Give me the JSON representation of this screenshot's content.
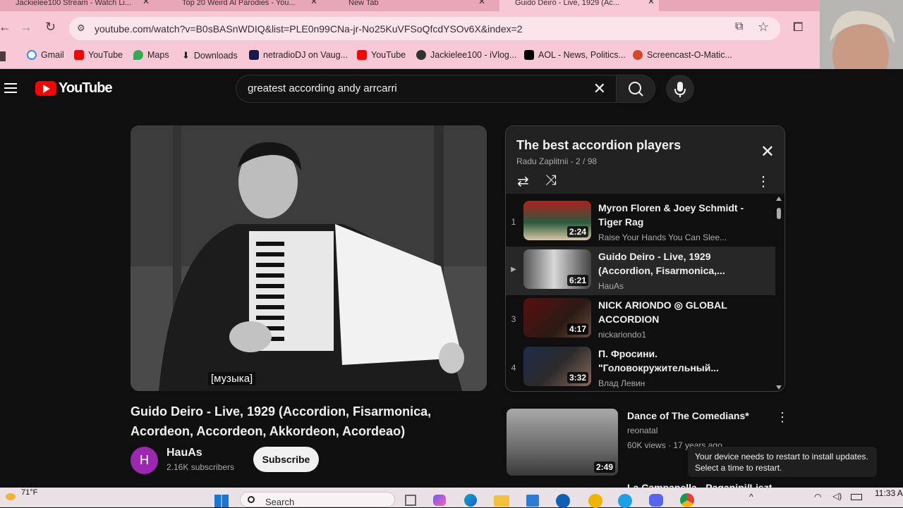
{
  "browser": {
    "tabs": [
      {
        "title": "Jackielee100 Stream - Watch Li..."
      },
      {
        "title": "Top 20 Weird Al Parodies - You..."
      },
      {
        "title": "New Tab"
      },
      {
        "title": "Guido Deiro - Live, 1929 (Ac..."
      }
    ],
    "url": "youtube.com/watch?v=B0sBASnWDIQ&list=PLE0n99CNa-jr-No25KuVFSoQfcdYSOv6X&index=2",
    "bookmarks": [
      {
        "label": "Gmail",
        "color": "#4285f4"
      },
      {
        "label": "YouTube",
        "color": "#ff0000"
      },
      {
        "label": "Maps",
        "color": "#34a853"
      },
      {
        "label": "Downloads",
        "color": "#3c3c3c"
      },
      {
        "label": "netradioDJ on Vaug...",
        "color": "#1a1a4a"
      },
      {
        "label": "YouTube",
        "color": "#ff0000"
      },
      {
        "label": "Jackielee100 - iVlog...",
        "color": "#333333"
      },
      {
        "label": "AOL - News, Politics...",
        "color": "#000000"
      },
      {
        "label": "Screencast-O-Matic...",
        "color": "#d04a2a"
      }
    ]
  },
  "header": {
    "logo": "YouTube",
    "search_value": "greatest according andy arrcarri"
  },
  "player": {
    "caption": "[музыка]"
  },
  "video": {
    "title": "Guido Deiro - Live, 1929 (Accordion, Fisarmonica, Acordeon, Accordeon, Akkordeon, Acordeao)",
    "channel": "HauAs",
    "channel_initial": "H",
    "subscribers": "2.16K subscribers",
    "subscribe_label": "Subscribe"
  },
  "playlist": {
    "title": "The best accordion players",
    "meta": "Radu Zaplitnii - 2 / 98",
    "items": [
      {
        "num": "1",
        "title": "Myron Floren & Joey Schmidt - Tiger Rag",
        "channel": "Raise Your Hands You Can Slee...",
        "duration": "2:24"
      },
      {
        "num": "▶",
        "title": "Guido Deiro - Live, 1929 (Accordion, Fisarmonica,...",
        "channel": "HauAs",
        "duration": "6:21"
      },
      {
        "num": "3",
        "title": "NICK ARIONDO ◎ GLOBAL ACCORDION",
        "channel": "nickariondo1",
        "duration": "4:17"
      },
      {
        "num": "4",
        "title": "П. Фросини. \"Головокружительный...",
        "channel": "Влад Левин",
        "duration": "3:32"
      }
    ]
  },
  "recommendation": {
    "title": "Dance of The Comedians*",
    "channel": "reonatal",
    "meta": "60K views · 17 years ago",
    "duration": "2:49",
    "next_title": "La Campanella - Paganini/Liszt"
  },
  "toast": {
    "line1": "Your device needs to restart to install updates.",
    "line2": "Select a time to restart."
  },
  "taskbar": {
    "weather": "71°F",
    "search_label": "Search",
    "time": "11:33 A"
  }
}
